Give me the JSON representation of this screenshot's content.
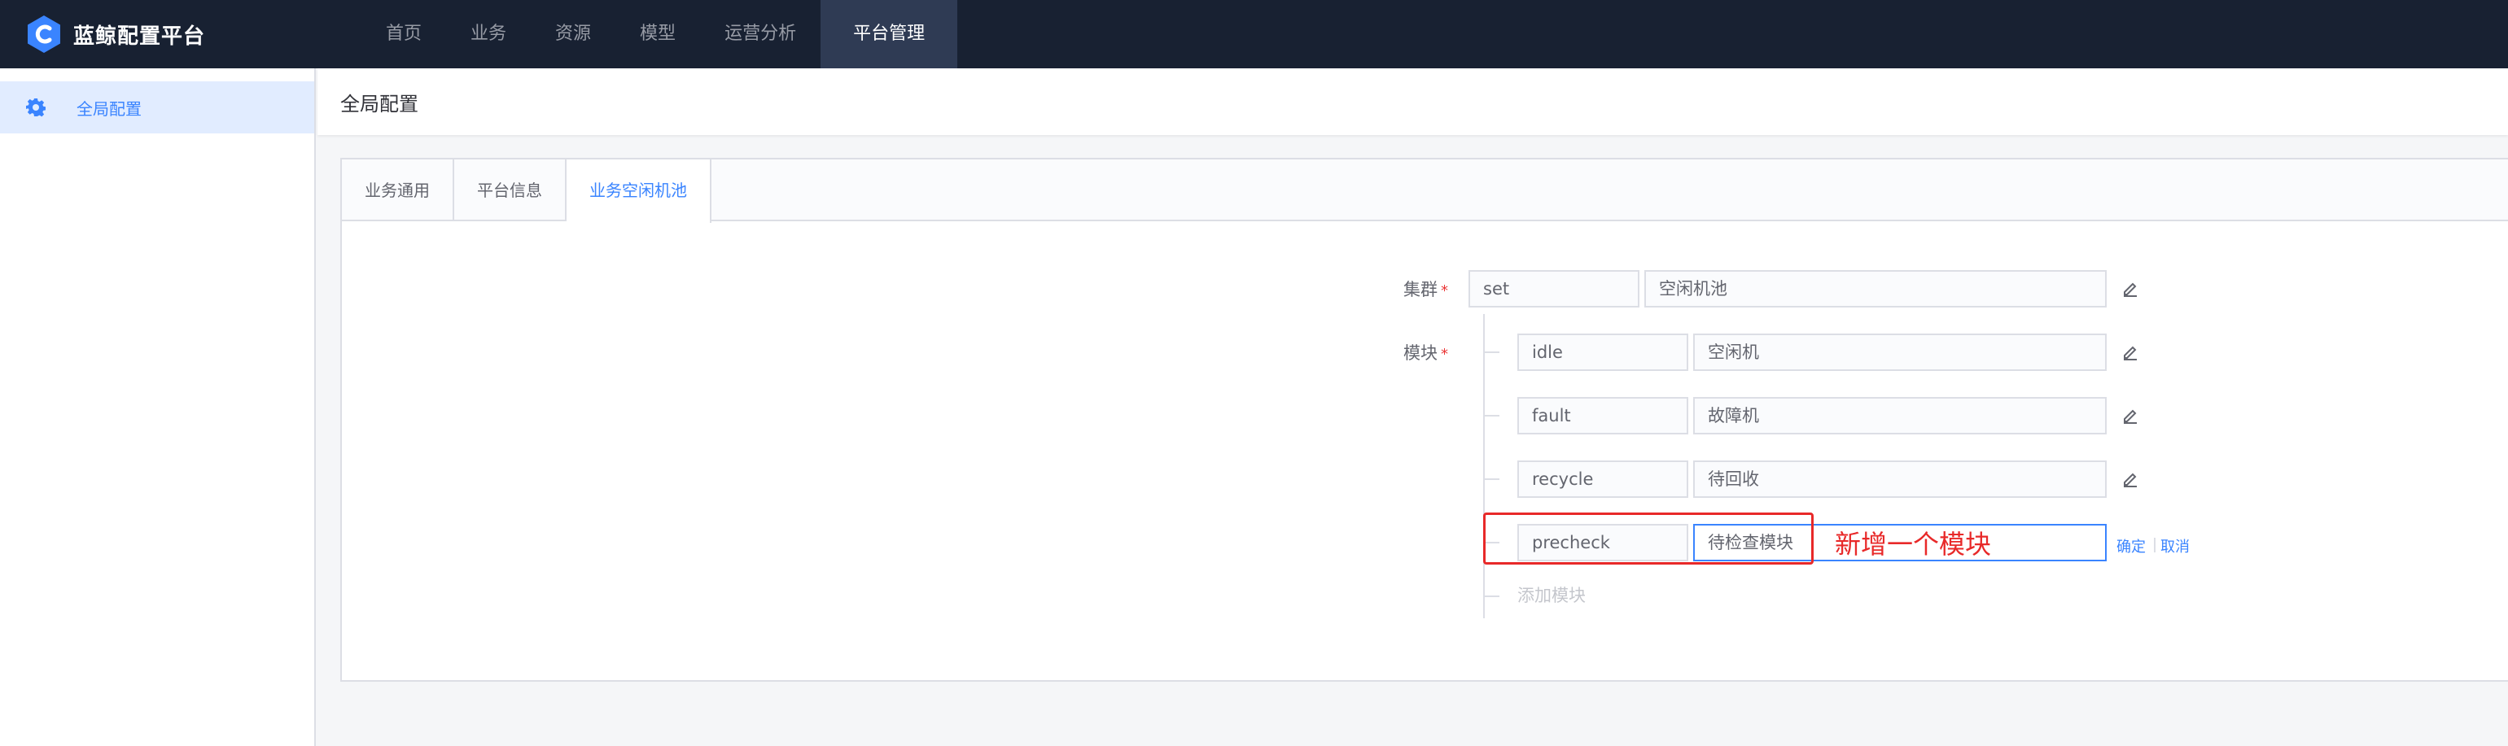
{
  "brand": {
    "name": "蓝鲸配置平台",
    "logo_icon": "bk-logo-icon"
  },
  "nav": {
    "items": [
      {
        "label": "首页"
      },
      {
        "label": "业务"
      },
      {
        "label": "资源"
      },
      {
        "label": "模型"
      },
      {
        "label": "运营分析"
      },
      {
        "label": "平台管理",
        "active": true
      }
    ]
  },
  "sidebar": {
    "items": [
      {
        "label": "全局配置",
        "icon": "gear-icon",
        "active": true
      }
    ]
  },
  "page": {
    "title": "全局配置"
  },
  "tabs": [
    {
      "label": "业务通用"
    },
    {
      "label": "平台信息"
    },
    {
      "label": "业务空闲机池",
      "active": true
    }
  ],
  "form": {
    "cluster": {
      "label": "集群",
      "required_mark": "*",
      "key": "set",
      "name": "空闲机池"
    },
    "modules": {
      "label": "模块",
      "required_mark": "*",
      "items": [
        {
          "key": "idle",
          "name": "空闲机"
        },
        {
          "key": "fault",
          "name": "故障机"
        },
        {
          "key": "recycle",
          "name": "待回收"
        }
      ],
      "new_item": {
        "key": "precheck",
        "name": "待检查模块",
        "confirm": "确定",
        "cancel": "取消"
      },
      "add_label": "添加模块"
    },
    "annotation": "新增一个模块"
  },
  "colors": {
    "accent": "#3a84ff",
    "topbar": "#182132",
    "highlight": "#e82929"
  }
}
